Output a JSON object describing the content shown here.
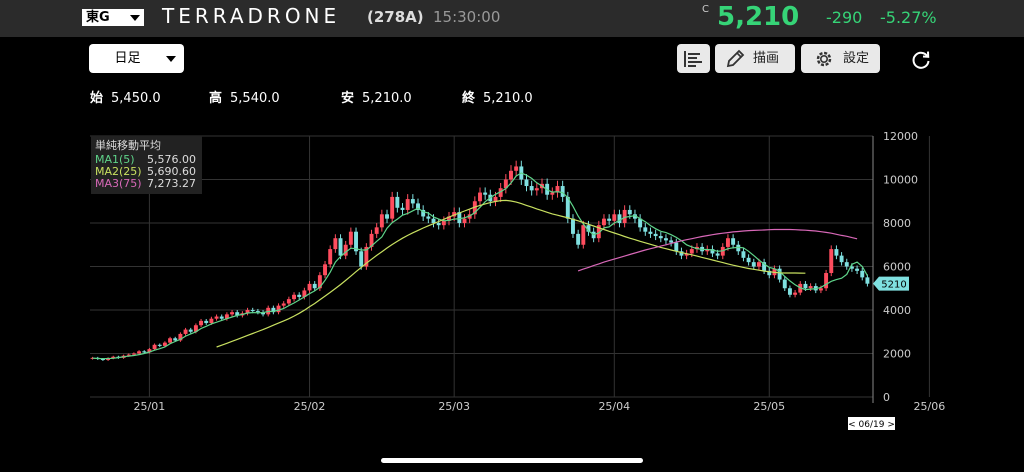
{
  "header": {
    "market": "東G",
    "name": "TERRADRONE",
    "code": "(278A)",
    "time": "15:30:00",
    "price_marker": "C",
    "price": "5,210",
    "change": "-290",
    "change_pct": "-5.27%",
    "accent_color": "#36d477"
  },
  "toolbar": {
    "period": "日足",
    "draw_label": "描画",
    "settings_label": "設定",
    "icons": [
      "bar-list-icon",
      "pencil-icon",
      "gear-icon",
      "refresh-icon"
    ]
  },
  "ohlc": [
    {
      "key": "始",
      "value": "5,450.0"
    },
    {
      "key": "高",
      "value": "5,540.0"
    },
    {
      "key": "安",
      "value": "5,210.0"
    },
    {
      "key": "終",
      "value": "5,210.0"
    }
  ],
  "legend": {
    "title": "単純移動平均",
    "items": [
      {
        "label": "MA1(5)",
        "value": "5,576.00",
        "color": "#5fd48a"
      },
      {
        "label": "MA2(25)",
        "value": "5,690.60",
        "color": "#c8e060"
      },
      {
        "label": "MA3(75)",
        "value": "7,273.27",
        "color": "#d868b8"
      }
    ]
  },
  "chart_data": {
    "type": "candlestick",
    "up_color": "#ff4d5e",
    "down_color": "#7fe0e0",
    "ylim": [
      0,
      12000
    ],
    "yticks": [
      "0",
      "2000",
      "4000",
      "6000",
      "8000",
      "10000",
      "12000"
    ],
    "xtick_labels": [
      "25/01",
      "25/02",
      "25/03",
      "25/04",
      "25/05",
      "25/06"
    ],
    "xtick_days": [
      11,
      42,
      70,
      101,
      131,
      162
    ],
    "x_start_label": "",
    "last_price_label": "5210",
    "date_marker": "< 06/19 >",
    "closes": [
      1800,
      1750,
      1700,
      1780,
      1850,
      1800,
      1900,
      1950,
      2000,
      2100,
      2050,
      2200,
      2400,
      2350,
      2500,
      2700,
      2600,
      2900,
      3100,
      3000,
      3300,
      3500,
      3400,
      3600,
      3700,
      3600,
      3800,
      3900,
      3750,
      3850,
      4000,
      3950,
      3900,
      3800,
      4100,
      3900,
      4200,
      4300,
      4500,
      4700,
      4600,
      4900,
      5200,
      5000,
      5600,
      6100,
      6800,
      7300,
      6500,
      7000,
      7600,
      6700,
      6000,
      6900,
      7500,
      7800,
      8400,
      8200,
      9200,
      8700,
      8600,
      9100,
      8900,
      8600,
      8300,
      8200,
      8000,
      7900,
      8100,
      8300,
      8500,
      8000,
      8200,
      8400,
      9000,
      9400,
      9300,
      9000,
      9200,
      9600,
      10000,
      10400,
      10600,
      10000,
      9700,
      9500,
      9600,
      9800,
      9300,
      9400,
      9700,
      9200,
      8200,
      7500,
      7000,
      7900,
      7600,
      7300,
      7900,
      8200,
      8100,
      8400,
      8000,
      8600,
      8400,
      8200,
      7800,
      7600,
      7500,
      7400,
      7300,
      7200,
      7100,
      6700,
      6500,
      6600,
      6800,
      6900,
      6700,
      6800,
      6600,
      6500,
      6900,
      7300,
      7000,
      6700,
      6400,
      6200,
      6000,
      6200,
      5800,
      5600,
      5900,
      5400,
      5000,
      4700,
      4800,
      5200,
      5000,
      5100,
      4900,
      5000,
      5700,
      6800,
      6500,
      6200,
      6000,
      5900,
      5800,
      5500,
      5210
    ],
    "ma1": [
      1790,
      1770,
      1760,
      1770,
      1780,
      1810,
      1850,
      1880,
      1910,
      1950,
      2000,
      2070,
      2150,
      2220,
      2300,
      2450,
      2550,
      2650,
      2800,
      2900,
      3000,
      3150,
      3250,
      3360,
      3440,
      3520,
      3600,
      3680,
      3750,
      3800,
      3860,
      3880,
      3870,
      3880,
      3930,
      3940,
      3990,
      4070,
      4200,
      4320,
      4460,
      4600,
      4750,
      4880,
      5050,
      5360,
      5740,
      6200,
      6460,
      6660,
      6840,
      6820,
      6760,
      6760,
      6940,
      7160,
      7360,
      7760,
      8020,
      8180,
      8360,
      8440,
      8560,
      8680,
      8520,
      8460,
      8280,
      8180,
      8100,
      8120,
      8180,
      8200,
      8240,
      8320,
      8480,
      8720,
      8980,
      9160,
      9320,
      9440,
      9580,
      9840,
      10160,
      10300,
      10200,
      10050,
      9850,
      9700,
      9520,
      9420,
      9440,
      9400,
      9170,
      8770,
      8320,
      7960,
      7640,
      7460,
      7540,
      7780,
      7820,
      8000,
      8120,
      8260,
      8300,
      8340,
      8200,
      8060,
      7880,
      7740,
      7620,
      7560,
      7460,
      7340,
      7180,
      7000,
      6900,
      6820,
      6790,
      6780,
      6760,
      6700,
      6720,
      6820,
      6860,
      6880,
      6860,
      6700,
      6500,
      6300,
      6120,
      5960,
      5900,
      5780,
      5540,
      5340,
      5160,
      5020,
      4940,
      4960,
      4980,
      5040,
      5180,
      5320,
      5400,
      5460,
      5640,
      6100,
      6200,
      6000,
      5576
    ],
    "ma2_start": 24,
    "ma2": [
      2300,
      2380,
      2470,
      2560,
      2650,
      2740,
      2830,
      2920,
      3010,
      3100,
      3200,
      3300,
      3400,
      3500,
      3600,
      3720,
      3850,
      3990,
      4150,
      4300,
      4470,
      4640,
      4810,
      4990,
      5170,
      5360,
      5560,
      5760,
      5960,
      6150,
      6330,
      6510,
      6680,
      6850,
      7010,
      7160,
      7300,
      7430,
      7550,
      7660,
      7770,
      7870,
      7970,
      8070,
      8170,
      8270,
      8370,
      8460,
      8550,
      8640,
      8730,
      8810,
      8880,
      8940,
      8990,
      9030,
      9040,
      9010,
      8960,
      8890,
      8810,
      8730,
      8650,
      8570,
      8490,
      8420,
      8360,
      8300,
      8240,
      8170,
      8100,
      8020,
      7940,
      7860,
      7780,
      7700,
      7620,
      7540,
      7460,
      7380,
      7300,
      7230,
      7160,
      7090,
      7020,
      6950,
      6880,
      6820,
      6760,
      6700,
      6640,
      6590,
      6540,
      6480,
      6420,
      6360,
      6300,
      6240,
      6180,
      6120,
      6060,
      6010,
      5960,
      5910,
      5870,
      5830,
      5790,
      5760,
      5730,
      5710,
      5700,
      5700,
      5700,
      5695,
      5690.6
    ],
    "ma3_start": 94,
    "ma3": [
      5800,
      5880,
      5960,
      6040,
      6120,
      6200,
      6270,
      6340,
      6410,
      6480,
      6550,
      6620,
      6690,
      6760,
      6820,
      6880,
      6940,
      7000,
      7060,
      7120,
      7180,
      7230,
      7280,
      7330,
      7380,
      7420,
      7460,
      7500,
      7530,
      7560,
      7590,
      7610,
      7630,
      7650,
      7660,
      7670,
      7680,
      7690,
      7700,
      7700,
      7700,
      7700,
      7690,
      7680,
      7670,
      7650,
      7630,
      7600,
      7570,
      7530,
      7480,
      7430,
      7390,
      7330,
      7273.27
    ]
  }
}
